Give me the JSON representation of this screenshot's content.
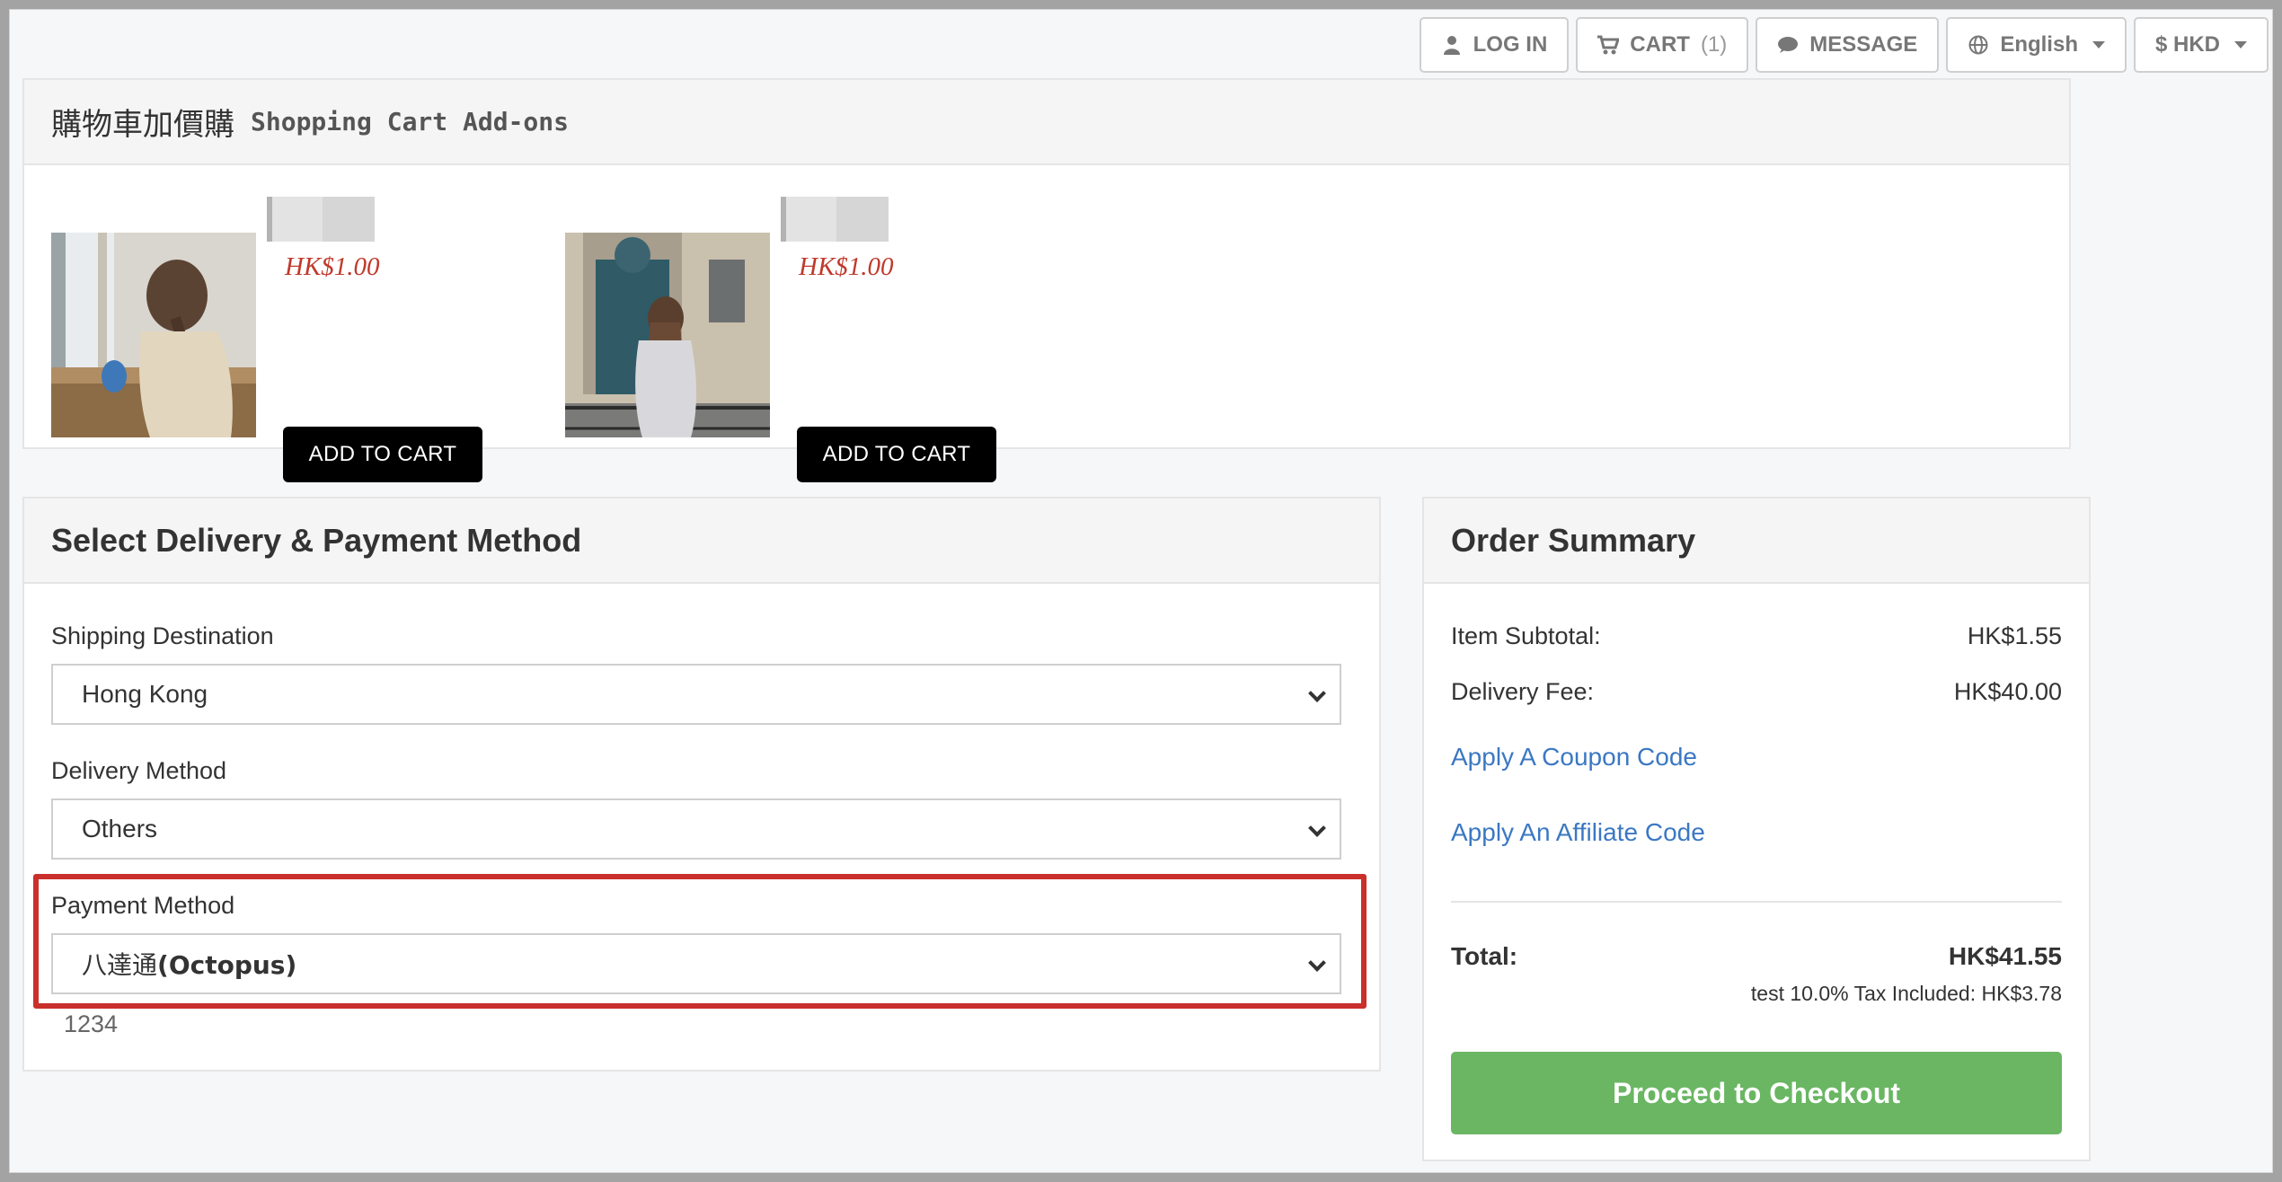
{
  "topbar": {
    "login_label": "LOG IN",
    "cart_label": "CART",
    "cart_count": "(1)",
    "message_label": "MESSAGE",
    "language_label": "English",
    "currency_label": "$ HKD"
  },
  "addons": {
    "title_zh": "購物車加價購",
    "title_en": "Shopping Cart Add-ons",
    "products": [
      {
        "price": "HK$1.00",
        "button_label": "ADD TO CART",
        "image_icon": "photo-woman-at-window"
      },
      {
        "price": "HK$1.00",
        "button_label": "ADD TO CART",
        "image_icon": "photo-woman-by-door"
      }
    ]
  },
  "delivery": {
    "title": "Select Delivery & Payment Method",
    "shipping_label": "Shipping Destination",
    "shipping_value": "Hong Kong",
    "method_label": "Delivery Method",
    "method_value": "Others",
    "payment_label": "Payment Method",
    "payment_value_zh": "八達通",
    "payment_value_en": "(Octopus)",
    "payment_note": "1234"
  },
  "summary": {
    "title": "Order Summary",
    "subtotal_label": "Item Subtotal:",
    "subtotal_value": "HK$1.55",
    "delivery_label": "Delivery Fee:",
    "delivery_value": "HK$40.00",
    "coupon_link": "Apply A Coupon Code",
    "affiliate_link": "Apply An Affiliate Code",
    "total_label": "Total:",
    "total_value": "HK$41.55",
    "tax_note": "test 10.0% Tax Included: HK$3.78",
    "checkout_label": "Proceed to Checkout"
  },
  "colors": {
    "price_red": "#c0392b",
    "link_blue": "#3b78c3",
    "checkout_green": "#6ab663",
    "highlight_red": "#c9302c"
  }
}
